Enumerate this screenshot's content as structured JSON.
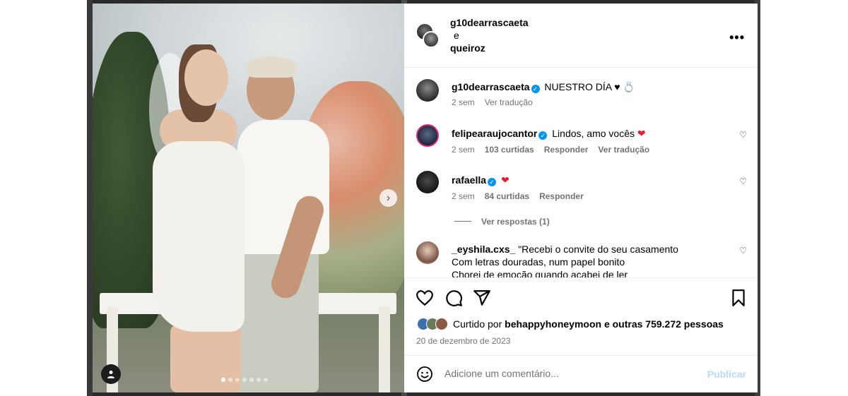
{
  "header": {
    "user1": "g10dearrascaeta",
    "and": "e",
    "user2": "queiroz"
  },
  "comments": [
    {
      "user": "g10dearrascaeta",
      "verified": true,
      "text": "NUESTRO DÍA ♥ 💍",
      "age": "2 sem",
      "translate": "Ver tradução"
    },
    {
      "user": "felipearaujocantor",
      "verified": true,
      "text": "Lindos, amo vocês",
      "age": "2 sem",
      "likes": "103 curtidas",
      "reply": "Responder",
      "translate": "Ver tradução"
    },
    {
      "user": "rafaella",
      "verified": true,
      "text": "",
      "age": "2 sem",
      "likes": "84 curtidas",
      "reply": "Responder",
      "view_replies": "Ver respostas (1)"
    },
    {
      "user": "_eyshila.cxs_",
      "verified": false,
      "text": "\"Recebi o convite do seu casamento",
      "line2": "Com letras douradas, num papel bonito",
      "line3": "Chorei de emoção quando acabei de ler"
    }
  ],
  "likes": {
    "prefix": "Curtido por",
    "user": "behappyhoneymoon",
    "suffix": "e outras 759.272 pessoas"
  },
  "date": "20 de dezembro de 2023",
  "comment_input": {
    "placeholder": "Adicione um comentário..."
  },
  "post_button": "Publicar",
  "icons": [
    "more-icon",
    "heart-icon",
    "comment-icon",
    "share-icon",
    "bookmark-icon",
    "emoji-icon",
    "tag-user-icon",
    "next-arrow-icon",
    "verified-icon"
  ],
  "colors": {
    "verified": "#0095f6",
    "heart": "#ed1b32",
    "post_disabled": "#b3dbff",
    "meta": "#737373"
  }
}
